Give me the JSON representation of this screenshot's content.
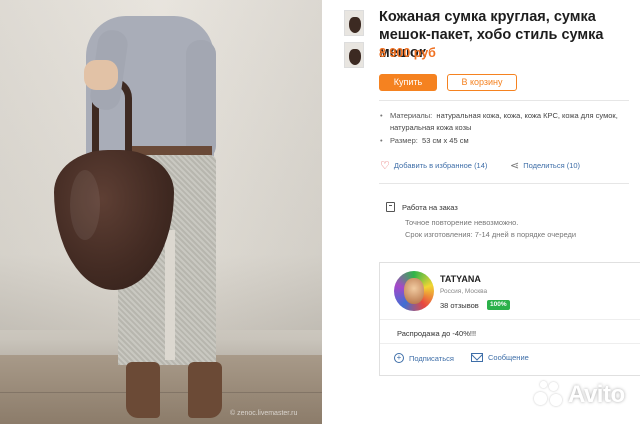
{
  "product": {
    "title": "Кожаная сумка круглая, сумка мешок-пакет, хобо стиль сумка мешок",
    "price": "8 900 руб"
  },
  "buttons": {
    "buy": "Купить",
    "cart": "В корзину"
  },
  "specs": {
    "materials_label": "Материалы:",
    "materials_value": "натуральная кожа, кожа, кожа КРС, кожа для сумок, натуральная кожа козы",
    "size_label": "Размер:",
    "size_value": "53 см х 45 см"
  },
  "actions": {
    "favorite": "Добавить в избранное (14)",
    "share": "Поделиться (10)"
  },
  "order": {
    "title": "Работа на заказ",
    "line1": "Точное повторение невозможно.",
    "line2": "Срок изготовления: 7-14 дней в порядке очереди"
  },
  "seller": {
    "name": "TATYANA",
    "location": "Россия, Москва",
    "reviews": "38 отзывов",
    "positive": "100%",
    "sale": "Распродажа до -40%!!!",
    "subscribe": "Подписаться",
    "message": "Сообщение"
  },
  "photo": {
    "watermark": "© zenoc.livemaster.ru"
  },
  "logo": {
    "text": "Avito"
  },
  "colors": {
    "accent": "#f58220",
    "price": "#f07020",
    "link": "#3e6ea8",
    "badge": "#2bb14a"
  }
}
